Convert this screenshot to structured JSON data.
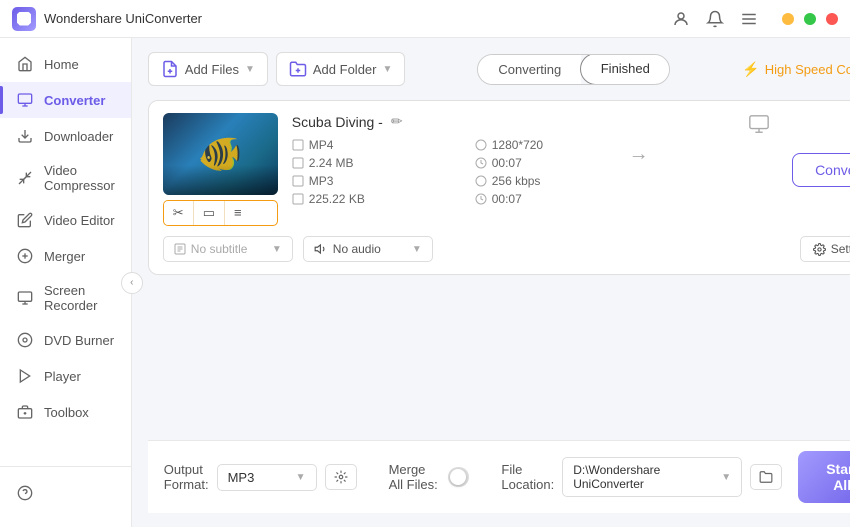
{
  "app": {
    "title": "Wondershare UniConverter",
    "logo_alt": "UniConverter Logo"
  },
  "titlebar": {
    "user_icon": "👤",
    "bell_icon": "🔔",
    "menu_icon": "☰",
    "minimize": "─",
    "maximize": "□",
    "close": "✕"
  },
  "sidebar": {
    "items": [
      {
        "id": "home",
        "label": "Home",
        "icon": "⌂"
      },
      {
        "id": "converter",
        "label": "Converter",
        "icon": "↕",
        "active": true
      },
      {
        "id": "downloader",
        "label": "Downloader",
        "icon": "⬇"
      },
      {
        "id": "video-compressor",
        "label": "Video Compressor",
        "icon": "⊞"
      },
      {
        "id": "video-editor",
        "label": "Video Editor",
        "icon": "✂"
      },
      {
        "id": "merger",
        "label": "Merger",
        "icon": "⊕"
      },
      {
        "id": "screen-recorder",
        "label": "Screen Recorder",
        "icon": "⊡"
      },
      {
        "id": "dvd-burner",
        "label": "DVD Burner",
        "icon": "⊙"
      },
      {
        "id": "player",
        "label": "Player",
        "icon": "▶"
      },
      {
        "id": "toolbox",
        "label": "Toolbox",
        "icon": "⊞"
      }
    ],
    "bottom_icons": [
      "?",
      "🔔",
      "↻"
    ]
  },
  "toolbar": {
    "add_file_label": "Add Files",
    "add_folder_label": "Add Folder",
    "tab_converting": "Converting",
    "tab_finished": "Finished",
    "speed_label": "High Speed Conversion"
  },
  "file": {
    "name": "Scuba Diving -",
    "source_format": "MP4",
    "source_resolution": "1280*720",
    "source_size": "2.24 MB",
    "source_duration": "00:07",
    "target_format": "MP3",
    "target_bitrate": "256 kbps",
    "target_size": "225.22 KB",
    "target_duration": "00:07",
    "subtitle_placeholder": "No subtitle",
    "audio_label": "No audio",
    "convert_btn": "Convert",
    "settings_btn": "Settings"
  },
  "bottom": {
    "output_format_label": "Output Format:",
    "output_format_value": "MP3",
    "merge_label": "Merge All Files:",
    "file_location_label": "File Location:",
    "file_location_value": "D:\\Wondershare UniConverter",
    "start_all_label": "Start All"
  }
}
